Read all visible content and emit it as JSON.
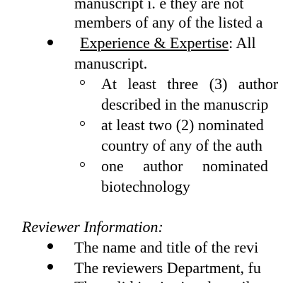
{
  "document": {
    "continuation_lines": [
      "manuscript i. e they are not",
      "members of any of the listed a"
    ],
    "experience_item": {
      "label": "Experience & Expertise",
      "suffix": ": All",
      "continuation": "manuscript."
    },
    "sub_items": [
      {
        "line1": "At least three (3) author",
        "line2": "described in the manuscrip"
      },
      {
        "line1": "at least two (2) nominated",
        "line2": "country of any of the auth"
      },
      {
        "line1": "one author nominated n",
        "line2": "biotechnology"
      }
    ],
    "reviewer_heading": "Reviewer Information:",
    "reviewer_items": [
      "The name and title of the revi",
      "The reviewers Department, fu"
    ],
    "partial_bottom_line": "The valid institutional email"
  }
}
